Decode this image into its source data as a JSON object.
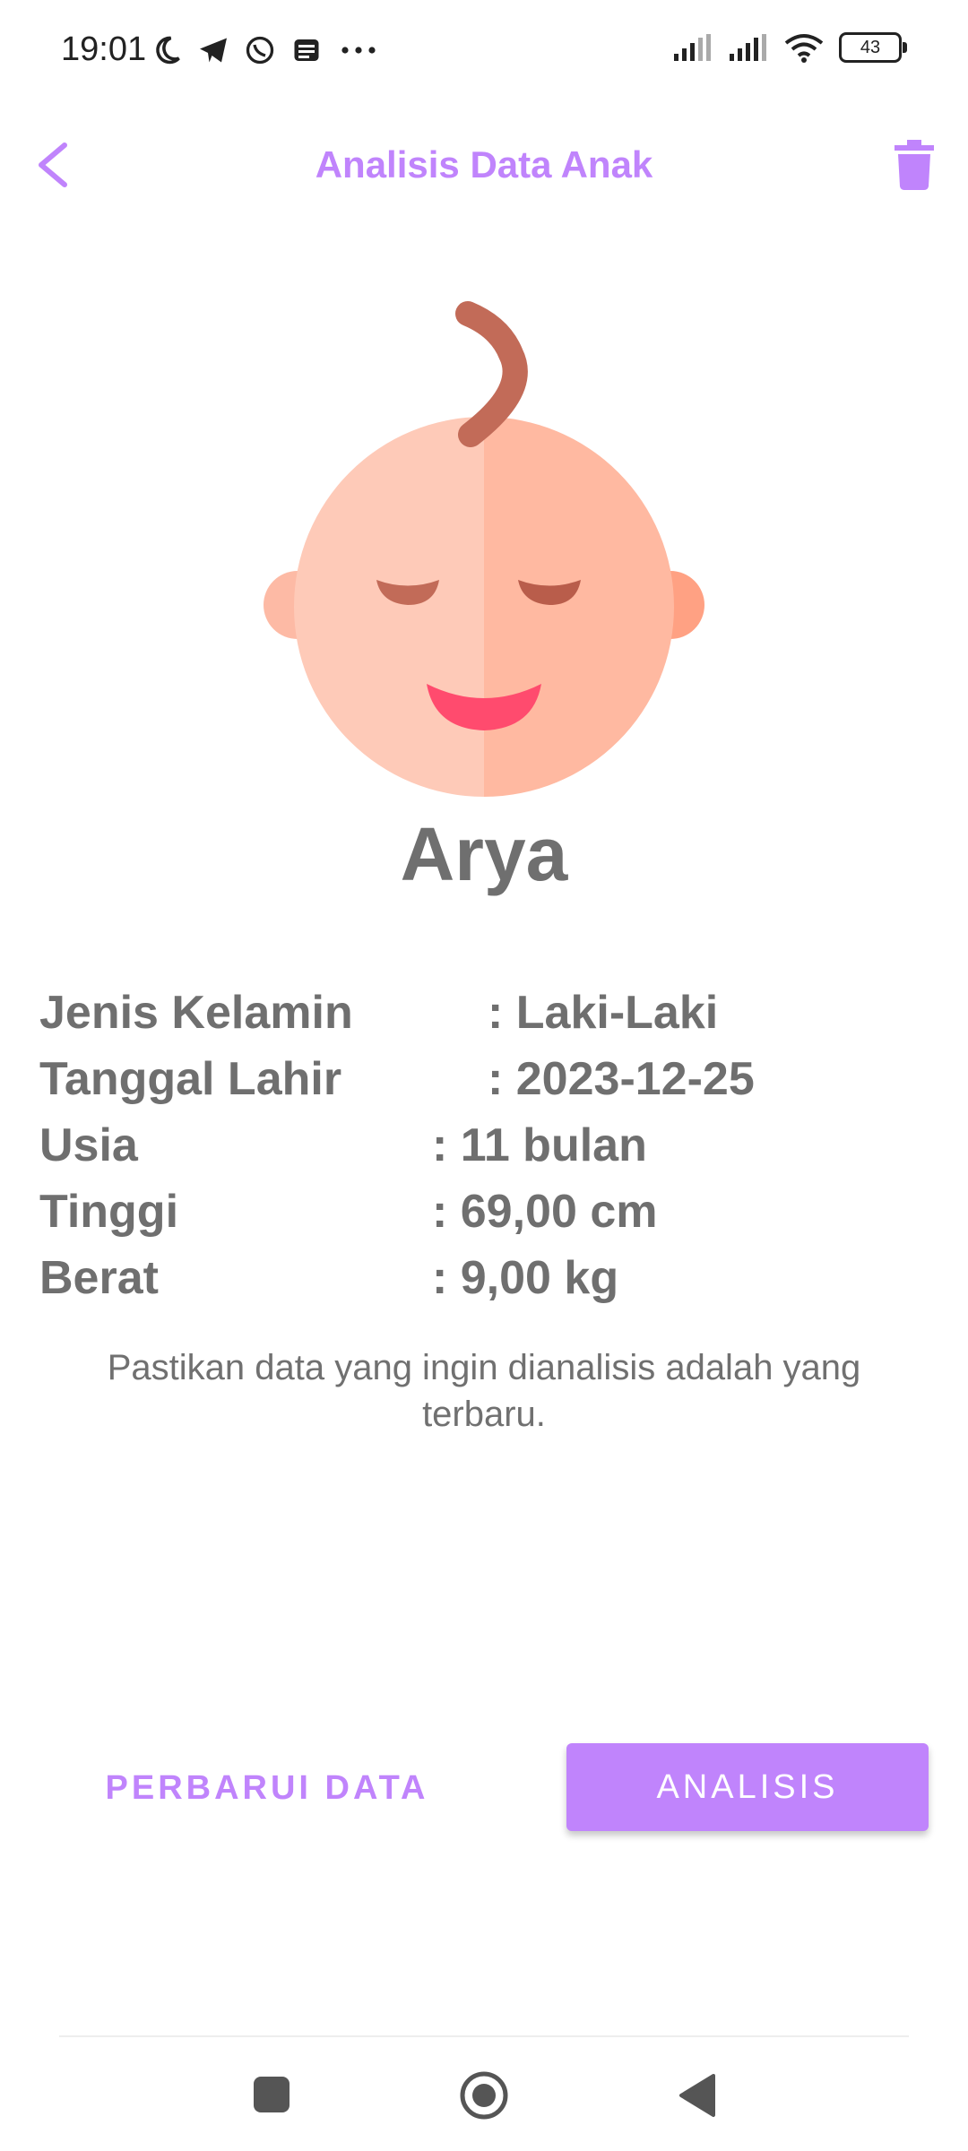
{
  "status": {
    "time": "19:01",
    "battery": "43",
    "icons": [
      "moon-icon",
      "telegram-icon",
      "whatsapp-icon",
      "notes-icon",
      "more-dots-icon",
      "signal-icon",
      "signal-icon",
      "wifi-icon",
      "battery-icon"
    ]
  },
  "header": {
    "title": "Analisis Data Anak",
    "back_icon": "chevron-left-icon",
    "delete_icon": "trash-icon"
  },
  "child": {
    "name": "Arya",
    "avatar_icon": "baby-face-icon"
  },
  "info": [
    {
      "label": "Jenis Kelamin",
      "value": ": Laki-Laki"
    },
    {
      "label": "Tanggal Lahir",
      "value": ": 2023-12-25"
    },
    {
      "label": "Usia",
      "value": ": 11 bulan"
    },
    {
      "label": "Tinggi",
      "value": ": 69,00 cm"
    },
    {
      "label": "Berat",
      "value": ": 9,00 kg"
    }
  ],
  "note": "Pastikan data yang ingin dianalisis adalah yang terbaru.",
  "actions": {
    "update_label": "PERBARUI DATA",
    "analyze_label": "ANALISIS"
  },
  "colors": {
    "accent": "#c084fc",
    "text": "#6f6f6f"
  }
}
